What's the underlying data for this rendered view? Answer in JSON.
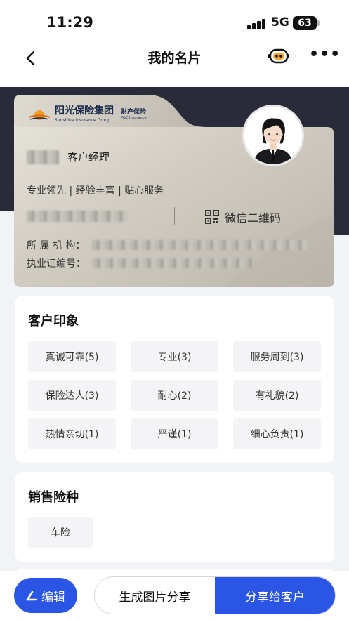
{
  "status_bar": {
    "time": "11:29",
    "network": "5G",
    "battery": "63"
  },
  "nav": {
    "title": "我的名片",
    "back_icon": "chevron-left-icon",
    "assistant_icon": "robot-icon",
    "more_icon": "more-icon"
  },
  "card": {
    "company_cn": "阳光保险集团",
    "company_en": "Sunshine Insurance Group",
    "division_cn": "财产保险",
    "division_en": "P&C Insurance",
    "role": "客户经理",
    "tagline": "专业领先 | 经验丰富 | 贴心服务",
    "wechat_label": "微信二维码",
    "org_label": "所 属 机 构：",
    "license_label": "执业证编号："
  },
  "impressions": {
    "title": "客户印象",
    "tags": [
      "真诚可靠(5)",
      "专业(3)",
      "服务周到(3)",
      "保险达人(3)",
      "耐心(2)",
      "有礼貌(2)",
      "热情亲切(1)",
      "严谨(1)",
      "细心负责(1)"
    ]
  },
  "products": {
    "title": "销售险种",
    "tags": [
      "车险"
    ]
  },
  "actions": {
    "edit": "编辑",
    "generate_image": "生成图片分享",
    "share": "分享给客户"
  },
  "colors": {
    "accent": "#2a55e5",
    "dark_band": "#292b38",
    "page_bg": "#f2f3f7"
  }
}
